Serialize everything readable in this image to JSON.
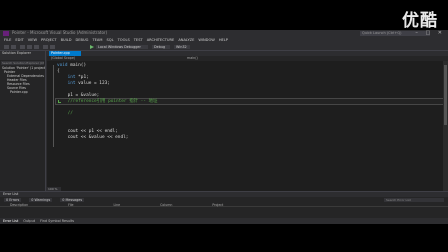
{
  "watermark": "优酷",
  "window": {
    "title": "Pointer - Microsoft Visual Studio (Administrator)",
    "quick_launch_placeholder": "Quick Launch (Ctrl+Q)",
    "controls": "– □ ✕"
  },
  "menu": [
    "FILE",
    "EDIT",
    "VIEW",
    "PROJECT",
    "BUILD",
    "DEBUG",
    "TEAM",
    "SQL",
    "TOOLS",
    "TEST",
    "ARCHITECTURE",
    "ANALYZE",
    "WINDOW",
    "HELP"
  ],
  "toolbar": {
    "debugger_label": "Local Windows Debugger",
    "config": "Debug",
    "platform": "Win32"
  },
  "solution_explorer": {
    "title": "Solution Explorer",
    "search_placeholder": "Search Solution Explorer (Ctrl+;)",
    "items": [
      "Solution 'Pointer' (1 project)",
      "Pointer",
      "External Dependencies",
      "Header Files",
      "Resource Files",
      "Source Files",
      "Pointer.cpp"
    ]
  },
  "editor": {
    "tab_label": "Pointer.cpp",
    "nav_left": "(Global Scope)",
    "nav_right": "main()",
    "zoom": "100 %",
    "lines": [
      {
        "kw": "void",
        "text": " main()"
      },
      {
        "kw": "",
        "text": "{"
      },
      {
        "kw": "    int",
        "text": " *p1;"
      },
      {
        "kw": "    int",
        "text": " value = 123;"
      },
      {
        "kw": "",
        "text": ""
      },
      {
        "kw": "",
        "text": "    p1 = &value;"
      },
      {
        "kw": "",
        "text": "    //reference引用 pointer 指针 -- 地址",
        "comment": true
      },
      {
        "kw": "",
        "text": ""
      },
      {
        "kw": "",
        "text": "    //",
        "comment": true
      },
      {
        "kw": "",
        "text": ""
      },
      {
        "kw": "",
        "text": ""
      },
      {
        "kw": "",
        "text": "    cout << p1 << endl;"
      },
      {
        "kw": "",
        "text": "    cout << &value << endl;"
      }
    ]
  },
  "error_list": {
    "title": "Error List",
    "filters": [
      "0 Errors",
      "0 Warnings",
      "0 Messages"
    ],
    "search_placeholder": "Search Error List",
    "columns": [
      "Description",
      "File",
      "Line",
      "Column",
      "Project"
    ]
  },
  "bottom_tabs": [
    "Error List",
    "Output",
    "Find Symbol Results"
  ]
}
